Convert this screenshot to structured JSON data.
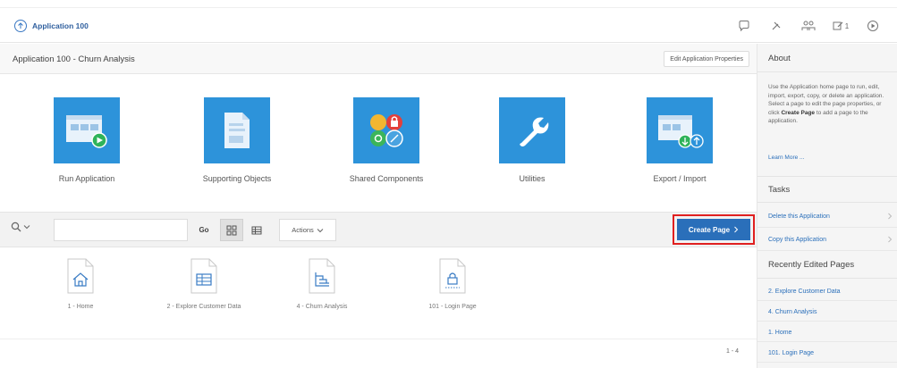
{
  "header": {
    "app_label": "Application 100",
    "badge_count": "1"
  },
  "main": {
    "title": "Application 100 - Churn Analysis",
    "edit_properties_label": "Edit Application Properties",
    "tiles": [
      {
        "label": "Run Application",
        "icon": "run-application-icon"
      },
      {
        "label": "Supporting Objects",
        "icon": "supporting-objects-icon"
      },
      {
        "label": "Shared Components",
        "icon": "shared-components-icon"
      },
      {
        "label": "Utilities",
        "icon": "wrench-icon"
      },
      {
        "label": "Export / Import",
        "icon": "export-import-icon"
      }
    ],
    "search": {
      "go_label": "Go",
      "actions_label": "Actions",
      "create_page_label": "Create Page"
    },
    "pages": [
      {
        "label": "1 - Home",
        "icon": "home-page-icon"
      },
      {
        "label": "2 - Explore Customer Data",
        "icon": "table-page-icon"
      },
      {
        "label": "4 - Churn Analysis",
        "icon": "chart-page-icon"
      },
      {
        "label": "101 - Login Page",
        "icon": "login-page-icon"
      }
    ],
    "pagination": "1 - 4"
  },
  "sidebar": {
    "about_title": "About",
    "about_text_1": "Use the Application home page to run, edit, import, export, copy, or delete an application. Select a page to edit the page properties, or click",
    "about_text_bold": "Create Page",
    "about_text_2": "to add a page to the application.",
    "learn_more": "Learn More ...",
    "tasks_title": "Tasks",
    "tasks": [
      {
        "label": "Delete this Application"
      },
      {
        "label": "Copy this Application"
      }
    ],
    "recent_title": "Recently Edited Pages",
    "recent": [
      {
        "label": "2. Explore Customer Data"
      },
      {
        "label": "4. Churn Analysis"
      },
      {
        "label": "1. Home"
      },
      {
        "label": "101. Login Page"
      }
    ]
  },
  "colors": {
    "tile_blue": "#2d93da",
    "link_blue": "#2a6fba",
    "highlight_red": "#e02020"
  }
}
